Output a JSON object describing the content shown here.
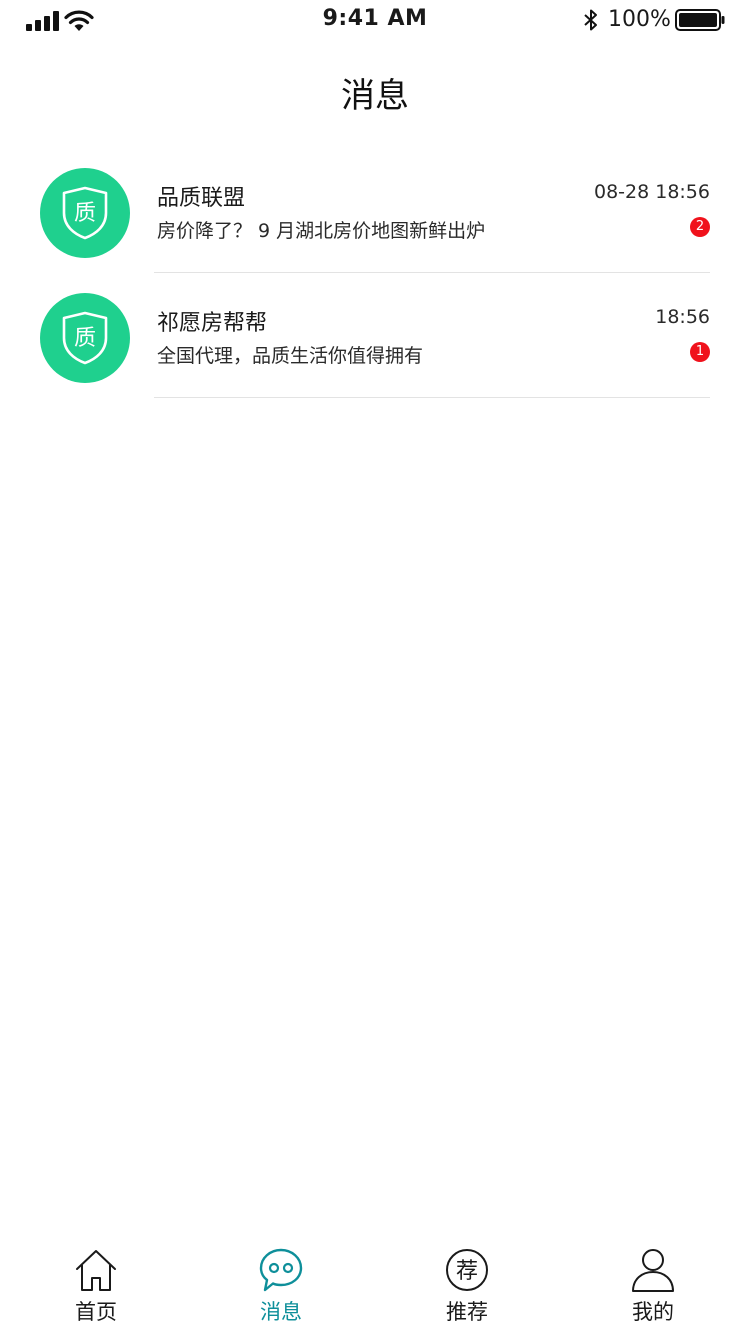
{
  "status_bar": {
    "time": "9:41 AM",
    "battery": "100%",
    "icons": [
      "signal-icon",
      "wifi-icon",
      "bluetooth-icon",
      "battery-icon"
    ]
  },
  "header": {
    "title": "消息"
  },
  "messages": [
    {
      "avatar_text": "质",
      "name": "品质联盟",
      "time": "08-28 18:56",
      "preview": "房价降了？ 9 月湖北房价地图新鲜出炉",
      "unread": "2"
    },
    {
      "avatar_text": "质",
      "name": "祁愿房帮帮",
      "time": "18:56",
      "preview": "全国代理，品质生活你值得拥有",
      "unread": "1"
    }
  ],
  "tabs": [
    {
      "label": "首页",
      "icon": "home-icon"
    },
    {
      "label": "消息",
      "icon": "message-icon",
      "active": true
    },
    {
      "label": "推荐",
      "icon": "recommend-icon",
      "icon_text": "荐"
    },
    {
      "label": "我的",
      "icon": "profile-icon"
    }
  ],
  "colors": {
    "avatar_green": "#1fd08e",
    "badge_red": "#f0121c",
    "active_tab": "#0e8f9a",
    "divider": "#e3e3e3"
  }
}
